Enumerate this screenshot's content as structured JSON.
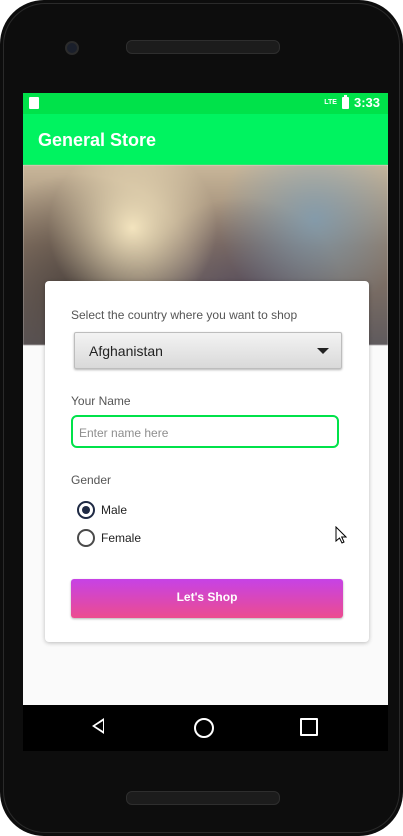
{
  "status_bar": {
    "time": "3:33",
    "network": "LTE",
    "left_icon": "sim-icon",
    "right_icon": "battery-icon"
  },
  "app_bar": {
    "title": "General Store"
  },
  "form": {
    "country_label": "Select the country where you want to shop",
    "country_selected": "Afghanistan",
    "name_label": "Your Name",
    "name_placeholder": "Enter name here",
    "gender_label": "Gender",
    "gender_options": [
      "Male",
      "Female"
    ],
    "gender_selected": "Male",
    "submit_label": "Let's  Shop"
  },
  "nav": {
    "back_icon": "back-icon",
    "home_icon": "home-icon",
    "recent_icon": "recent-apps-icon"
  },
  "colors": {
    "accent": "#00f360",
    "button_gradient": [
      "#c642e6",
      "#ec4c8f"
    ]
  }
}
